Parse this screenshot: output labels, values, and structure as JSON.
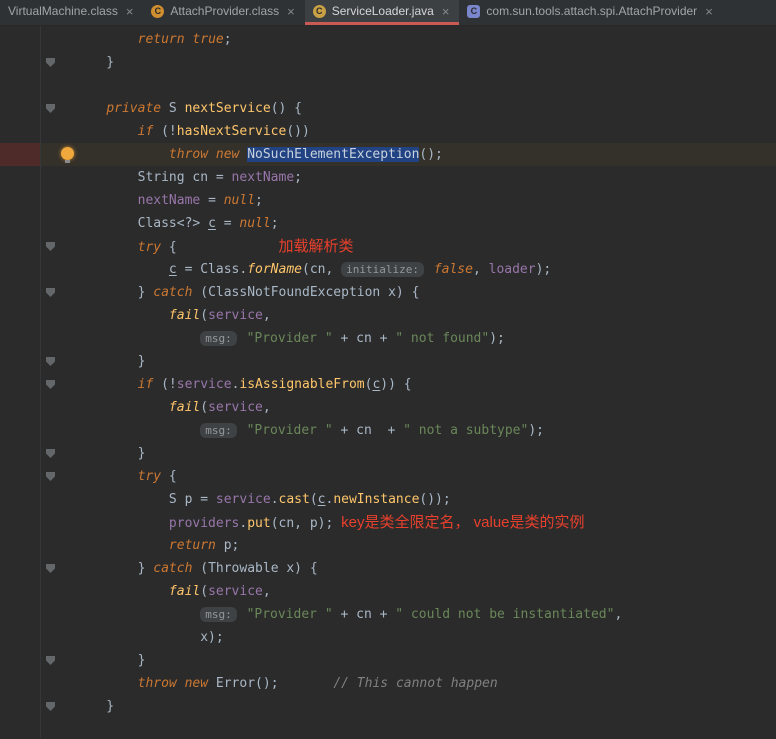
{
  "tab_bar": {
    "close_glyph": "×",
    "active_underline_color": "#cb5a54",
    "tabs": [
      {
        "label": "VirtualMachine.class",
        "icon": null,
        "active": false
      },
      {
        "label": "AttachProvider.class",
        "icon": {
          "letter": "C",
          "color": "#cf8e2f",
          "shape": "circle"
        },
        "active": false
      },
      {
        "label": "ServiceLoader.java",
        "icon": {
          "letter": "C",
          "color": "#caa044",
          "shape": "circle"
        },
        "active": true
      },
      {
        "label": "com.sun.tools.attach.spi.AttachProvider",
        "icon": {
          "letter": "C",
          "color": "#7986cb",
          "shape": "square"
        },
        "active": false
      }
    ]
  },
  "editor": {
    "file_language": "java",
    "lines": [
      {
        "seg": [
          [
            "        ",
            "pl"
          ],
          [
            "return",
            "kw"
          ],
          [
            " ",
            "pl"
          ],
          [
            "true",
            "kw"
          ],
          [
            ";",
            "pl"
          ]
        ]
      },
      {
        "g": "fold",
        "seg": [
          [
            "    }",
            "pl"
          ]
        ]
      },
      {
        "seg": []
      },
      {
        "g": "fold",
        "seg": [
          [
            "    ",
            "pl"
          ],
          [
            "private",
            "kw"
          ],
          [
            " S ",
            "pl"
          ],
          [
            "nextService",
            "mc"
          ],
          [
            "() {",
            "pl"
          ]
        ]
      },
      {
        "seg": [
          [
            "        ",
            "pl"
          ],
          [
            "if",
            "kw"
          ],
          [
            " (!",
            "pl"
          ],
          [
            "hasNextService",
            "mc"
          ],
          [
            "())",
            "pl"
          ]
        ]
      },
      {
        "g": "bulb",
        "hl": true,
        "seg": [
          [
            "            ",
            "pl"
          ],
          [
            "throw",
            "kw"
          ],
          [
            " ",
            "pl"
          ],
          [
            "new",
            "kw"
          ],
          [
            " ",
            "pl"
          ],
          [
            "NoSuchElementException",
            "se"
          ],
          [
            "();",
            "pl"
          ]
        ]
      },
      {
        "seg": [
          [
            "        String cn = ",
            "pl"
          ],
          [
            "nextName",
            "fl"
          ],
          [
            ";",
            "pl"
          ]
        ]
      },
      {
        "seg": [
          [
            "        ",
            "pl"
          ],
          [
            "nextName",
            "fl"
          ],
          [
            " = ",
            "pl"
          ],
          [
            "null",
            "kw"
          ],
          [
            ";",
            "pl"
          ]
        ]
      },
      {
        "seg": [
          [
            "        Class<?> ",
            "pl"
          ],
          [
            "c",
            "un"
          ],
          [
            " = ",
            "pl"
          ],
          [
            "null",
            "kw"
          ],
          [
            ";",
            "pl"
          ]
        ]
      },
      {
        "g": "fold",
        "seg": [
          [
            "        ",
            "pl"
          ],
          [
            "try",
            "kw"
          ],
          [
            " {",
            "pl"
          ],
          [
            "             ",
            "pl"
          ],
          [
            "加载解析类",
            "no"
          ]
        ]
      },
      {
        "seg": [
          [
            "            ",
            "pl"
          ],
          [
            "c",
            "un"
          ],
          [
            " = Class.",
            "pl"
          ],
          [
            "forName",
            "ms"
          ],
          [
            "(cn, ",
            "pl"
          ],
          [
            "initialize:",
            "hi"
          ],
          [
            " ",
            "pl"
          ],
          [
            "false",
            "kw"
          ],
          [
            ", ",
            "pl"
          ],
          [
            "loader",
            "fl"
          ],
          [
            ");",
            "pl"
          ]
        ]
      },
      {
        "g": "fold",
        "seg": [
          [
            "        } ",
            "pl"
          ],
          [
            "catch",
            "kw"
          ],
          [
            " (ClassNotFoundException x) {",
            "pl"
          ]
        ]
      },
      {
        "seg": [
          [
            "            ",
            "pl"
          ],
          [
            "fail",
            "ms"
          ],
          [
            "(",
            "pl"
          ],
          [
            "service",
            "fl"
          ],
          [
            ",",
            "pl"
          ]
        ]
      },
      {
        "seg": [
          [
            "                ",
            "pl"
          ],
          [
            "msg:",
            "hi"
          ],
          [
            " ",
            "pl"
          ],
          [
            "\"Provider \"",
            "st"
          ],
          [
            " + cn + ",
            "pl"
          ],
          [
            "\" not found\"",
            "st"
          ],
          [
            ");",
            "pl"
          ]
        ]
      },
      {
        "g": "fold",
        "seg": [
          [
            "        }",
            "pl"
          ]
        ]
      },
      {
        "g": "fold",
        "seg": [
          [
            "        ",
            "pl"
          ],
          [
            "if",
            "kw"
          ],
          [
            " (!",
            "pl"
          ],
          [
            "service",
            "fl"
          ],
          [
            ".",
            "pl"
          ],
          [
            "isAssignableFrom",
            "mc"
          ],
          [
            "(",
            "pl"
          ],
          [
            "c",
            "un"
          ],
          [
            ")) {",
            "pl"
          ]
        ]
      },
      {
        "seg": [
          [
            "            ",
            "pl"
          ],
          [
            "fail",
            "ms"
          ],
          [
            "(",
            "pl"
          ],
          [
            "service",
            "fl"
          ],
          [
            ",",
            "pl"
          ]
        ]
      },
      {
        "seg": [
          [
            "                ",
            "pl"
          ],
          [
            "msg:",
            "hi"
          ],
          [
            " ",
            "pl"
          ],
          [
            "\"Provider \"",
            "st"
          ],
          [
            " + cn  + ",
            "pl"
          ],
          [
            "\" not a subtype\"",
            "st"
          ],
          [
            ");",
            "pl"
          ]
        ]
      },
      {
        "g": "fold",
        "seg": [
          [
            "        }",
            "pl"
          ]
        ]
      },
      {
        "g": "fold",
        "seg": [
          [
            "        ",
            "pl"
          ],
          [
            "try",
            "kw"
          ],
          [
            " {",
            "pl"
          ]
        ]
      },
      {
        "seg": [
          [
            "            S p = ",
            "pl"
          ],
          [
            "service",
            "fl"
          ],
          [
            ".",
            "pl"
          ],
          [
            "cast",
            "mc"
          ],
          [
            "(",
            "pl"
          ],
          [
            "c",
            "un"
          ],
          [
            ".",
            "pl"
          ],
          [
            "newInstance",
            "mc"
          ],
          [
            "());",
            "pl"
          ]
        ]
      },
      {
        "seg": [
          [
            "            ",
            "pl"
          ],
          [
            "providers",
            "fl"
          ],
          [
            ".",
            "pl"
          ],
          [
            "put",
            "mc"
          ],
          [
            "(cn, p); ",
            "pl"
          ],
          [
            "key是类全限定名， value是类的实例",
            "no"
          ]
        ]
      },
      {
        "seg": [
          [
            "            ",
            "pl"
          ],
          [
            "return",
            "kw"
          ],
          [
            " p;",
            "pl"
          ]
        ]
      },
      {
        "g": "fold",
        "seg": [
          [
            "        } ",
            "pl"
          ],
          [
            "catch",
            "kw"
          ],
          [
            " (Throwable x) {",
            "pl"
          ]
        ]
      },
      {
        "seg": [
          [
            "            ",
            "pl"
          ],
          [
            "fail",
            "ms"
          ],
          [
            "(",
            "pl"
          ],
          [
            "service",
            "fl"
          ],
          [
            ",",
            "pl"
          ]
        ]
      },
      {
        "seg": [
          [
            "                ",
            "pl"
          ],
          [
            "msg:",
            "hi"
          ],
          [
            " ",
            "pl"
          ],
          [
            "\"Provider \"",
            "st"
          ],
          [
            " + cn + ",
            "pl"
          ],
          [
            "\" could not be instantiated\"",
            "st"
          ],
          [
            ",",
            "pl"
          ]
        ]
      },
      {
        "seg": [
          [
            "                x);",
            "pl"
          ]
        ]
      },
      {
        "g": "fold",
        "seg": [
          [
            "        }",
            "pl"
          ]
        ]
      },
      {
        "seg": [
          [
            "        ",
            "pl"
          ],
          [
            "throw",
            "kw"
          ],
          [
            " ",
            "pl"
          ],
          [
            "new",
            "kw"
          ],
          [
            " Error();",
            "pl"
          ],
          [
            "       ",
            "pl"
          ],
          [
            "// This cannot happen",
            "cm"
          ]
        ]
      },
      {
        "g": "fold",
        "seg": [
          [
            "    }",
            "pl"
          ]
        ]
      }
    ]
  }
}
